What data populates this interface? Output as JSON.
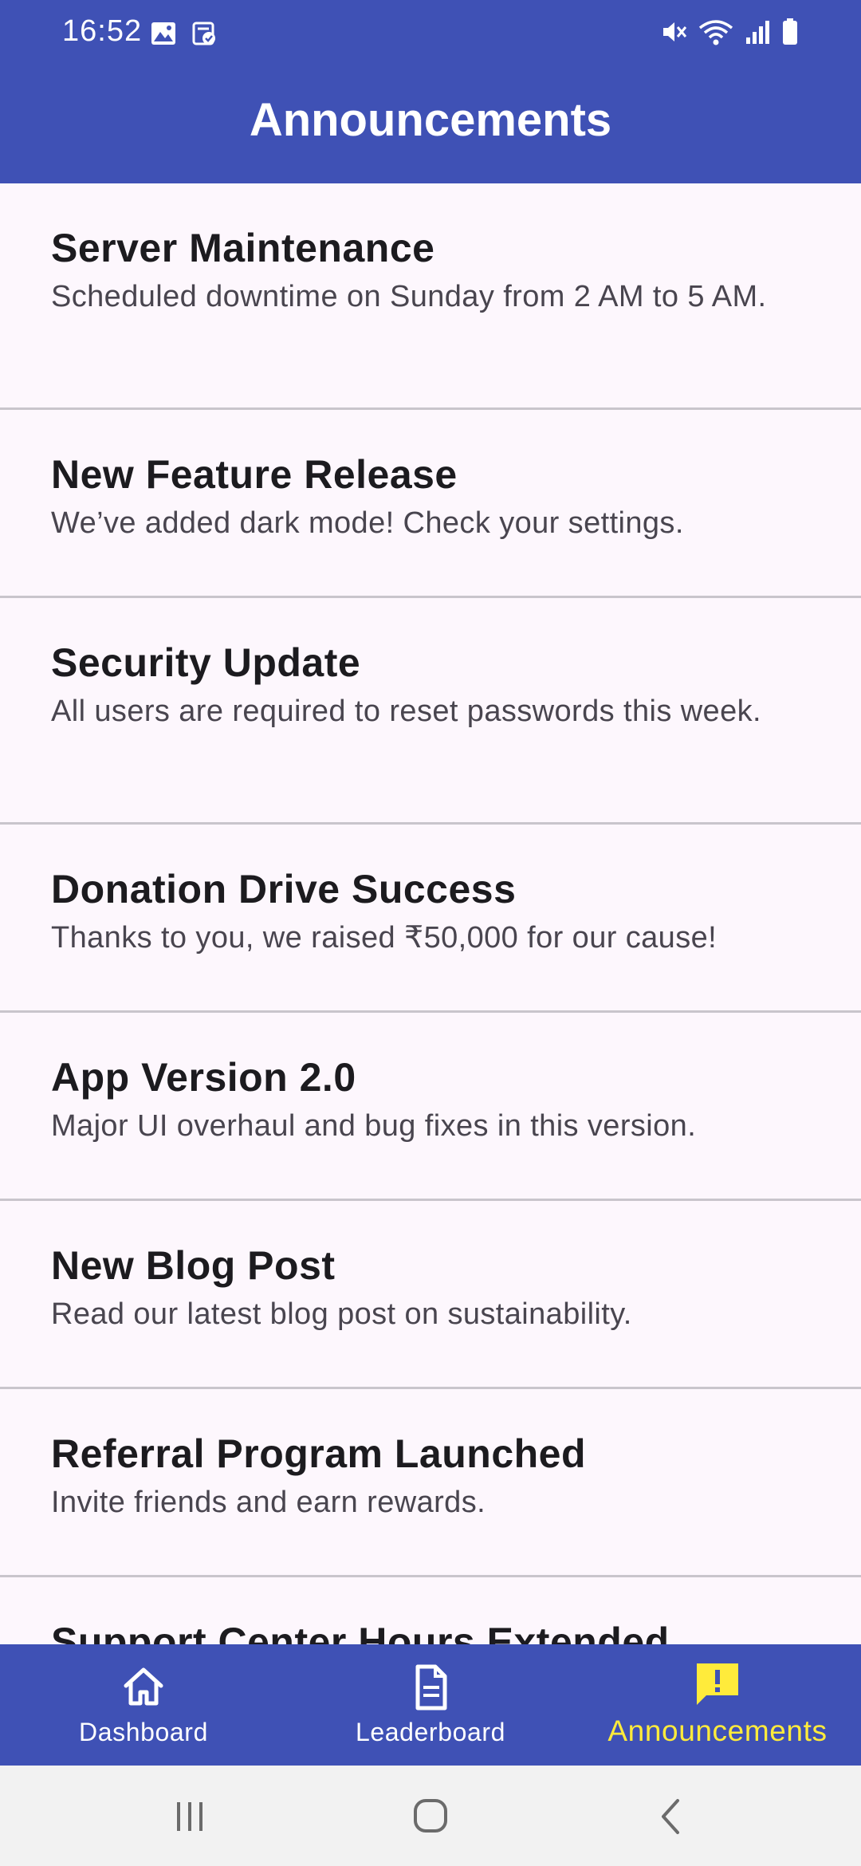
{
  "status_bar": {
    "time": "16:52",
    "left_icons": [
      "image-icon",
      "task-check-icon"
    ],
    "right_icons": [
      "mute-icon",
      "wifi-icon",
      "signal-icon",
      "battery-icon"
    ]
  },
  "app_bar": {
    "title": "Announcements"
  },
  "announcements": [
    {
      "title": "Server Maintenance",
      "description": "Scheduled downtime on Sunday from 2 AM to 5 AM."
    },
    {
      "title": "New Feature Release",
      "description": "We’ve added dark mode! Check your settings."
    },
    {
      "title": "Security Update",
      "description": "All users are required to reset passwords this week."
    },
    {
      "title": "Donation Drive Success",
      "description": "Thanks to you, we raised ₹50,000 for our cause!"
    },
    {
      "title": "App Version 2.0",
      "description": "Major UI overhaul and bug fixes in this version."
    },
    {
      "title": "New Blog Post",
      "description": "Read our latest blog post on sustainability."
    },
    {
      "title": "Referral Program Launched",
      "description": "Invite friends and earn rewards."
    },
    {
      "title": "Support Center Hours Extended",
      "description": ""
    }
  ],
  "bottom_nav": {
    "items": [
      {
        "label": "Dashboard",
        "icon": "home-icon",
        "active": false
      },
      {
        "label": "Leaderboard",
        "icon": "document-icon",
        "active": false
      },
      {
        "label": "Announcements",
        "icon": "announcement-icon",
        "active": true
      }
    ]
  },
  "system_nav": {
    "buttons": [
      "recents-icon",
      "home-circle-icon",
      "back-icon"
    ]
  },
  "colors": {
    "primary": "#3F51B5",
    "active": "#FFEB3B",
    "background": "#FDF7FD",
    "title_text": "#1C1B1F",
    "body_text": "#49454F",
    "divider": "#C9C5CC"
  }
}
